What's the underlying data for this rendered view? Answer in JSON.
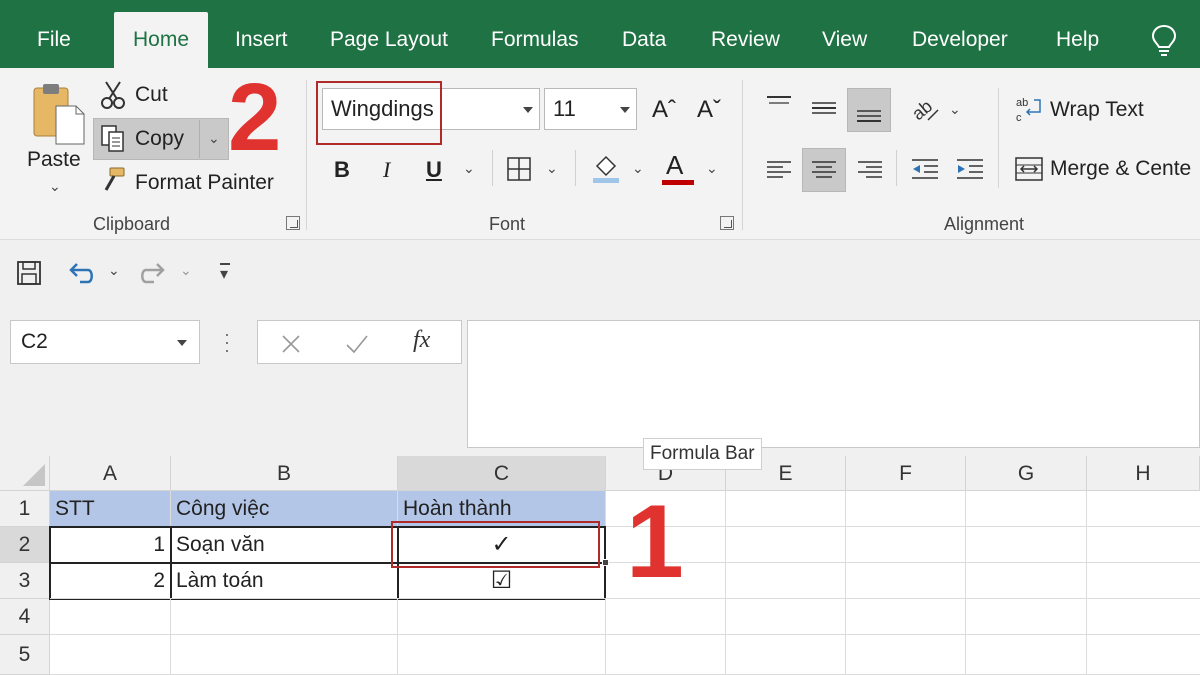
{
  "tabs": [
    {
      "label": "File",
      "active": false
    },
    {
      "label": "Home",
      "active": true
    },
    {
      "label": "Insert",
      "active": false
    },
    {
      "label": "Page Layout",
      "active": false
    },
    {
      "label": "Formulas",
      "active": false
    },
    {
      "label": "Data",
      "active": false
    },
    {
      "label": "Review",
      "active": false
    },
    {
      "label": "View",
      "active": false
    },
    {
      "label": "Developer",
      "active": false
    },
    {
      "label": "Help",
      "active": false
    }
  ],
  "clipboard": {
    "paste_label": "Paste",
    "cut_label": "Cut",
    "copy_label": "Copy",
    "format_painter_label": "Format Painter",
    "group_label": "Clipboard"
  },
  "font": {
    "font_name": "Wingdings",
    "font_size": "11",
    "bold_label": "B",
    "italic_label": "I",
    "underline_label": "U",
    "font_color_label": "A",
    "group_label": "Font"
  },
  "alignment": {
    "wrap_text_label": "Wrap Text",
    "merge_center_label": "Merge & Cente",
    "group_label": "Alignment"
  },
  "annotations": {
    "step_font": "2",
    "step_cell": "1"
  },
  "name_box": "C2",
  "tooltip": "Formula Bar",
  "columns": [
    "A",
    "B",
    "C",
    "D",
    "E",
    "F",
    "G",
    "H"
  ],
  "rows": [
    "1",
    "2",
    "3",
    "4",
    "5"
  ],
  "cells": {
    "A1": "STT",
    "B1": "Công việc",
    "C1": "Hoàn thành",
    "A2": "1",
    "B2": "Soạn văn",
    "C2": "✓",
    "A3": "2",
    "B3": "Làm toán",
    "C3": "☑"
  },
  "colors": {
    "ribbon_tab_bar": "#1f7244",
    "header_fill": "#b4c6e7",
    "annotation_red": "#e0332f"
  }
}
